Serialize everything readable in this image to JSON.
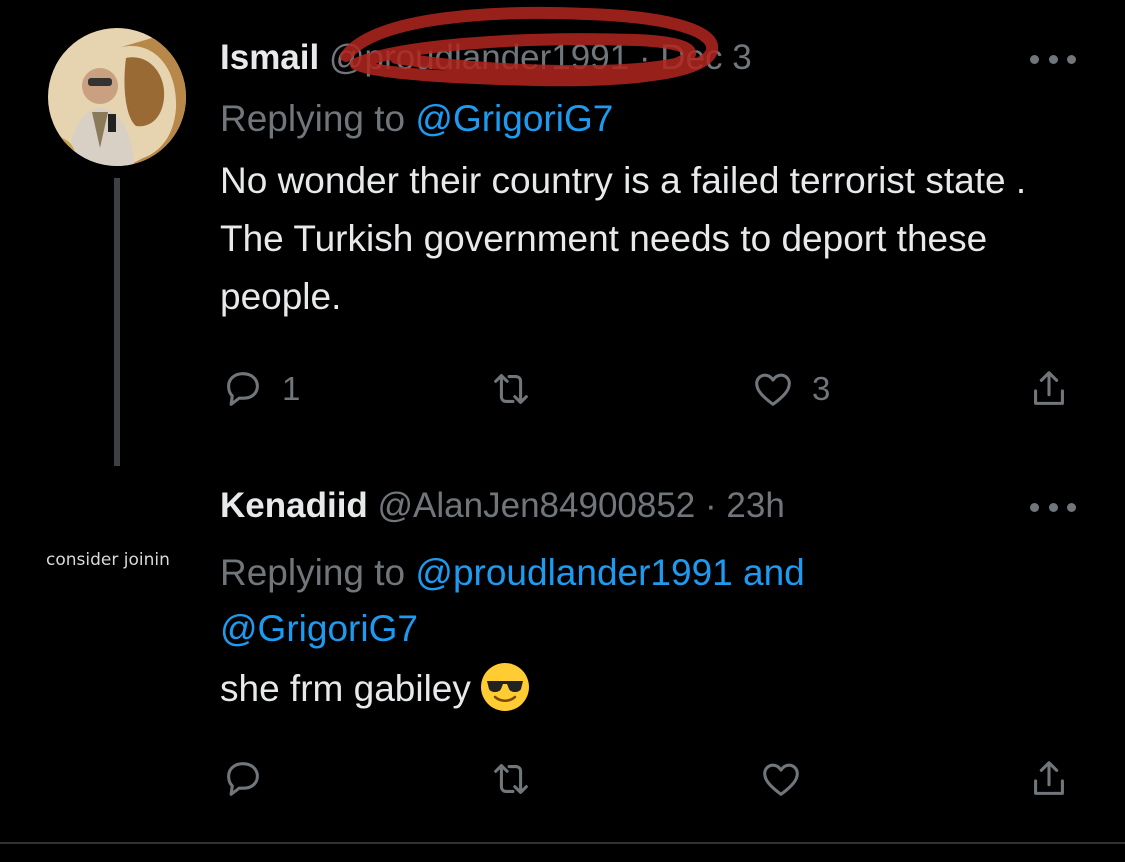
{
  "tweets": [
    {
      "author_name": "Ismail",
      "handle": "@proudlander1991",
      "separator": "·",
      "time": "Dec 3",
      "replying_prefix": "Replying to ",
      "replying_to": "@GrigoriG7",
      "text": "No wonder their country is a failed terrorist state . The Turkish government needs to deport these people.",
      "reply_count": "1",
      "retweet_count": "",
      "like_count": "3"
    },
    {
      "author_name": "Kenadiid",
      "handle": "@AlanJen84900852",
      "separator": "·",
      "time": "23h",
      "avatar_text": "consider joinin",
      "replying_prefix": "Replying to ",
      "replying_to_1": "@proudlander1991",
      "replying_joiner": " and",
      "replying_to_2": "@GrigoriG7",
      "text": "she frm gabiley",
      "emoji_icon": "sunglasses-emoji-icon",
      "reply_count": "",
      "retweet_count": "",
      "like_count": ""
    }
  ],
  "colors": {
    "background": "#000000",
    "primary_text": "#e7e9ea",
    "secondary_text": "#71767b",
    "link": "#1d9bf0",
    "scribble": "#b3261e"
  }
}
